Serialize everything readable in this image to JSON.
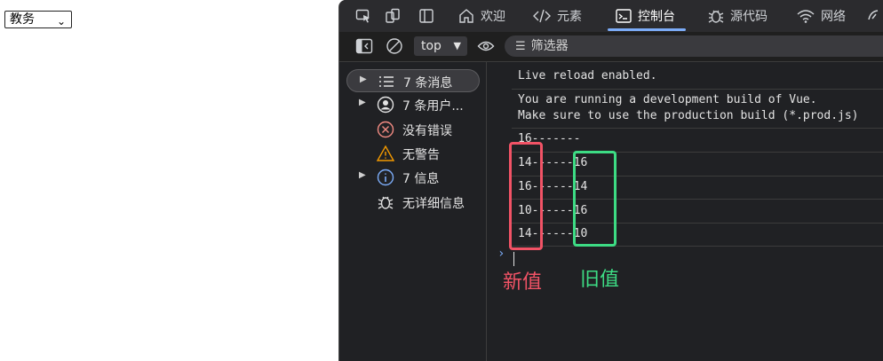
{
  "page": {
    "select": {
      "value": "教务"
    }
  },
  "devtools": {
    "tabs": [
      {
        "label": "欢迎",
        "icon": "home-icon"
      },
      {
        "label": "元素",
        "icon": "code-icon"
      },
      {
        "label": "控制台",
        "icon": "console-icon",
        "active": true
      },
      {
        "label": "源代码",
        "icon": "bug-icon"
      },
      {
        "label": "网络",
        "icon": "wifi-icon"
      }
    ],
    "toolbar": {
      "context": "top",
      "filter_placeholder": "筛选器"
    },
    "sidebar": {
      "items": [
        {
          "label": "7 条消息",
          "icon": "list-icon",
          "expandable": true,
          "selected": true
        },
        {
          "label": "7 条用户...",
          "icon": "user-icon",
          "expandable": true
        },
        {
          "label": "没有错误",
          "icon": "error-icon",
          "color": "#f28b82"
        },
        {
          "label": "无警告",
          "icon": "warning-icon",
          "color": "#f29900"
        },
        {
          "label": "7 信息",
          "icon": "info-icon",
          "expandable": true,
          "color": "#7cacf8"
        },
        {
          "label": "无详细信息",
          "icon": "bug-icon"
        }
      ]
    },
    "console": {
      "lines": [
        "Live reload enabled.",
        "You are running a development build of Vue.",
        "Make sure to use the production build (*.prod.js)",
        "16-------",
        "14------16",
        "16------14",
        "10------16",
        "14------10"
      ]
    }
  },
  "annotations": {
    "new_value": "新值",
    "old_value": "旧值",
    "new_color": "#f25366",
    "old_color": "#3ddc84"
  }
}
